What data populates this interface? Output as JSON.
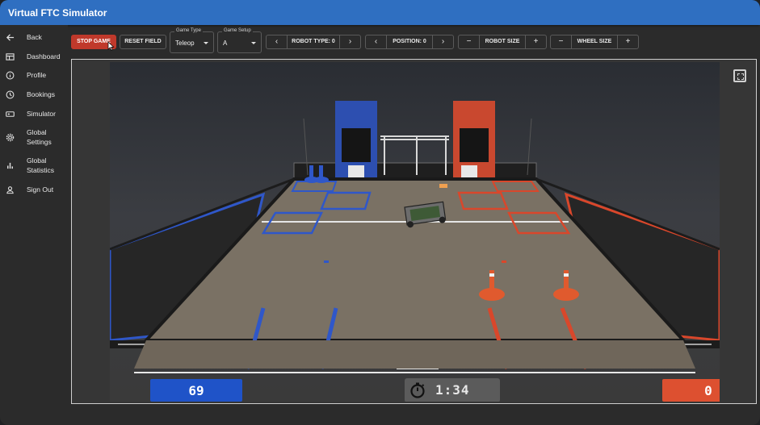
{
  "app": {
    "title": "Virtual FTC Simulator"
  },
  "sidebar": {
    "items": [
      {
        "label": "Back",
        "icon": "arrow-left-icon"
      },
      {
        "label": "Dashboard",
        "icon": "dashboard-icon"
      },
      {
        "label": "Profile",
        "icon": "info-icon"
      },
      {
        "label": "Bookings",
        "icon": "clock-icon"
      },
      {
        "label": "Simulator",
        "icon": "gamepad-icon"
      },
      {
        "label": "Global Settings",
        "icon": "gear-icon"
      },
      {
        "label": "Global Statistics",
        "icon": "bar-chart-icon"
      },
      {
        "label": "Sign Out",
        "icon": "person-icon"
      }
    ]
  },
  "toolbar": {
    "stop_label": "STOP GAME",
    "reset_label": "RESET FIELD",
    "game_type": {
      "legend": "Game Type",
      "value": "Teleop"
    },
    "game_setup": {
      "legend": "Game Setup",
      "value": "A"
    },
    "robot_type_label": "ROBOT TYPE: 0",
    "position_label": "POSITION: 0",
    "robot_size_label": "ROBOT SIZE",
    "wheel_size_label": "WHEEL SIZE",
    "prev_glyph": "‹",
    "next_glyph": "›",
    "minus_glyph": "−",
    "plus_glyph": "+"
  },
  "scoreboard": {
    "blue_score": "69",
    "red_score": "0",
    "timer": "1:34"
  },
  "colors": {
    "appbar": "#2f6fc1",
    "blue_alliance": "#1f53c8",
    "red_alliance": "#dd5030",
    "stop_button": "#c0392b"
  }
}
